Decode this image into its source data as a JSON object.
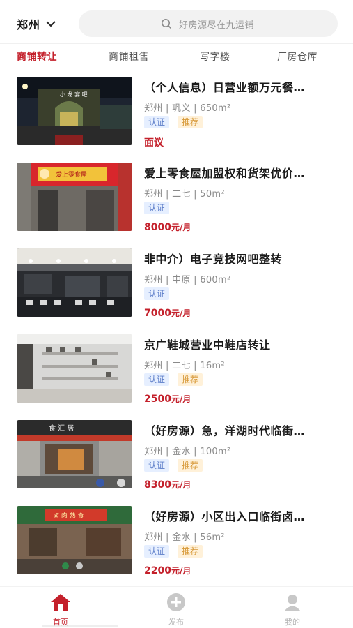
{
  "header": {
    "city": "郑州",
    "search_placeholder": "好房源尽在九运铺"
  },
  "tabs": [
    {
      "label": "商铺转让",
      "active": true
    },
    {
      "label": "商铺租售",
      "active": false
    },
    {
      "label": "写字楼",
      "active": false
    },
    {
      "label": "厂房仓库",
      "active": false
    }
  ],
  "listings": [
    {
      "title": "（个人信息）日营业额万元餐…",
      "meta": "郑州 | 巩义 | 650m²",
      "tags": [
        "认证",
        "推荐"
      ],
      "price": "面议",
      "unit": "",
      "image_text": "小 龙 宴 吧"
    },
    {
      "title": "爱上零食屋加盟权和货架优价…",
      "meta": "郑州 | 二七 | 50m²",
      "tags": [
        "认证"
      ],
      "price": "8000",
      "unit": "元/月",
      "image_text": "爱上零食屋"
    },
    {
      "title": "非中介）电子竞技网吧整转",
      "meta": "郑州 | 中原 | 600m²",
      "tags": [
        "认证"
      ],
      "price": "7000",
      "unit": "元/月",
      "image_text": ""
    },
    {
      "title": "京广鞋城营业中鞋店转让",
      "meta": "郑州 | 二七 | 16m²",
      "tags": [
        "认证",
        "推荐"
      ],
      "price": "2500",
      "unit": "元/月",
      "image_text": ""
    },
    {
      "title": "（好房源）急，洋湖时代临街…",
      "meta": "郑州 | 金水 | 100m²",
      "tags": [
        "认证",
        "推荐"
      ],
      "price": "8300",
      "unit": "元/月",
      "image_text": "食 汇 居"
    },
    {
      "title": "（好房源）小区出入口临街卤…",
      "meta": "郑州 | 金水 | 56m²",
      "tags": [
        "认证",
        "推荐"
      ],
      "price": "2200",
      "unit": "元/月",
      "image_text": "卤 肉 熟 食"
    }
  ],
  "bottom_nav": [
    {
      "label": "首页",
      "icon": "home-icon",
      "active": true
    },
    {
      "label": "发布",
      "icon": "plus-circle-icon",
      "active": false
    },
    {
      "label": "我的",
      "icon": "user-icon",
      "active": false
    }
  ],
  "colors": {
    "accent": "#c4202b",
    "cert_bg": "#e6efff",
    "rec_bg": "#fff1d9"
  }
}
